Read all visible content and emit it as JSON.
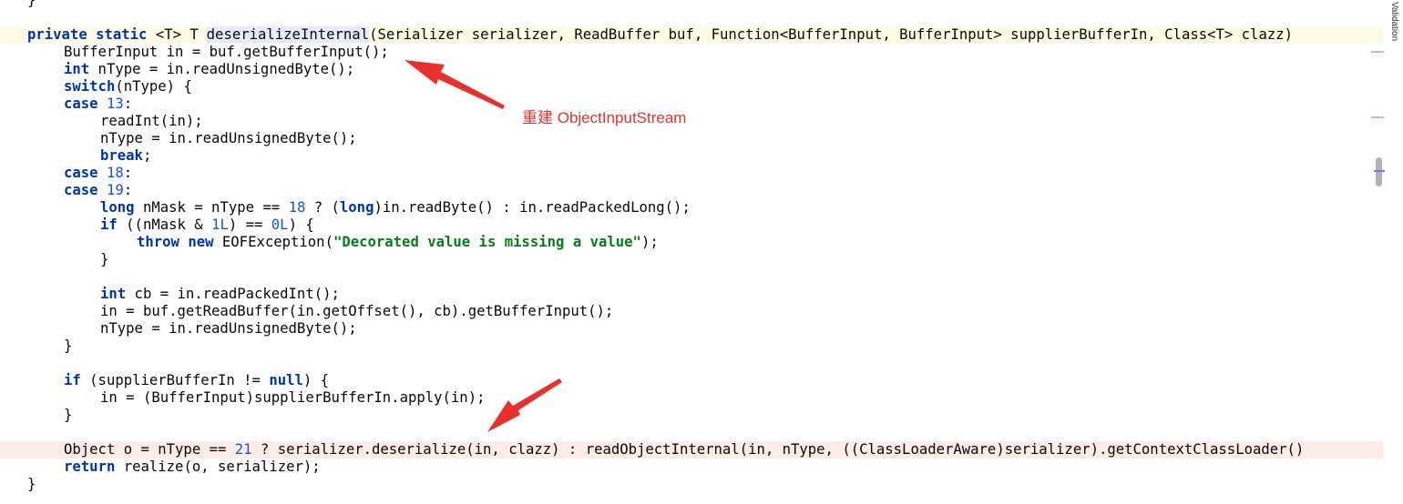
{
  "editor": {
    "lines": {
      "l0": "}",
      "l1": {
        "private": "private",
        "static": "static",
        "generic": " <T> T ",
        "method": "deserializeInternal",
        "params": "(Serializer serializer, ReadBuffer buf, Function<BufferInput, BufferInput> supplierBufferIn, Class<T> clazz)"
      },
      "l2": "BufferInput in = buf.getBufferInput();",
      "l3": {
        "kw": "int",
        "rest": " nType = in.readUnsignedByte();"
      },
      "l4": {
        "kw": "switch",
        "rest": "(nType) {"
      },
      "l5": {
        "kw": "case",
        "num": "13",
        "rest": ":"
      },
      "l6": "readInt(in);",
      "l7": "nType = in.readUnsignedByte();",
      "l8": {
        "kw": "break",
        "rest": ";"
      },
      "l9": {
        "kw": "case",
        "num": "18",
        "rest": ":"
      },
      "l10": {
        "kw": "case",
        "num": "19",
        "rest": ":"
      },
      "l11": {
        "kw1": "long",
        "a": " nMask = nType == ",
        "num": "18",
        "b": " ? (",
        "kw2": "long",
        "c": ")in.readByte() : in.readPackedLong();"
      },
      "l12": {
        "kw": "if",
        "a": " ((nMask & ",
        "num1": "1L",
        "b": ") == ",
        "num2": "0L",
        "c": ") {"
      },
      "l13": {
        "kw1": "throw",
        "kw2": "new",
        "a": " EOFException(",
        "str": "\"Decorated value is missing a value\"",
        "b": ");"
      },
      "l14": "}",
      "l15": {
        "kw": "int",
        "rest": " cb = in.readPackedInt();"
      },
      "l16": "in = buf.getReadBuffer(in.getOffset(), cb).getBufferInput();",
      "l17": "nType = in.readUnsignedByte();",
      "l18": "}",
      "l19": {
        "kw1": "if",
        "a": " (supplierBufferIn != ",
        "kw2": "null",
        "b": ") {"
      },
      "l20": "in = (BufferInput)supplierBufferIn.apply(in);",
      "l21": "}",
      "l22": {
        "a": "Object o = nType == ",
        "num": "21",
        "b": " ? serializer.deserialize(in, clazz) : readObjectInternal(in, nType, ((ClassLoaderAware)serializer).getContextClassLoader()"
      },
      "l23": {
        "kw": "return",
        "rest": " realize(o, serializer);"
      },
      "l24": "}"
    }
  },
  "annotation": {
    "text": "重建 ObjectInputStream",
    "color": "#e8302d"
  },
  "right_stripe": {
    "label": "Validation"
  },
  "colors": {
    "keyword": "#0033b3",
    "number": "#1750eb",
    "string": "#067d17",
    "caret_line": "#fffae3",
    "highlight_line": "#fbece8"
  }
}
